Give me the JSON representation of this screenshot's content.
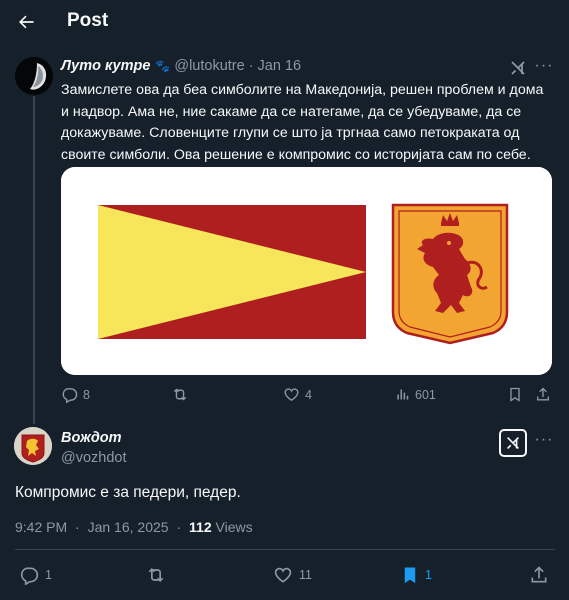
{
  "header": {
    "title": "Post"
  },
  "post1": {
    "display_name": "Лутo кутре",
    "handle": "@lutokutre",
    "separator": "·",
    "date": "Jan 16",
    "text": "Замислете ова да беа симболите на Македонија, решен проблем и дома и надвор. Ама не, ние сакаме да се натегаме, да се убедуваме, да се докажуваме. Словенците глупи се што ја тргнаа само петокраката од своите симболи. Ова решение е компромис со историјата сам по себе.",
    "replies": "8",
    "retweets": "",
    "likes": "4",
    "views": "601"
  },
  "post2": {
    "display_name": "Вождот",
    "handle": "@vozhdot",
    "text": "Компромис е за педери, педер.",
    "time": "9:42 PM",
    "separator": "·",
    "date": "Jan 16, 2025",
    "separator2": "·",
    "views_count": "112",
    "views_label": "Views",
    "replies": "1",
    "retweets": "",
    "likes": "11",
    "bookmarks": "1"
  },
  "colors": {
    "background": "#15202b",
    "text": "#f7f9f9",
    "muted": "#8b98a5",
    "accent": "#1d9bf0",
    "flag_red": "#b01f1f",
    "flag_yellow": "#f7e55a",
    "shield_orange": "#f3a531"
  },
  "icons": {
    "back": "arrow-left-icon",
    "grok": "grok-icon",
    "more": "more-dots-icon",
    "reply": "reply-icon",
    "retweet": "retweet-icon",
    "like": "heart-icon",
    "views": "views-icon",
    "bookmark": "bookmark-icon",
    "share": "share-icon"
  }
}
